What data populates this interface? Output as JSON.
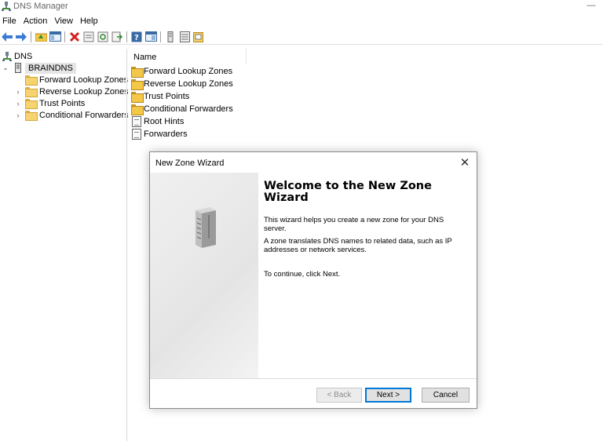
{
  "window": {
    "title": "DNS Manager",
    "minimize": "—"
  },
  "menu": [
    "File",
    "Action",
    "View",
    "Help"
  ],
  "tree": {
    "root": "DNS",
    "server": "BRAINDNS",
    "children": [
      "Forward Lookup Zones",
      "Reverse Lookup Zones",
      "Trust Points",
      "Conditional Forwarders"
    ]
  },
  "list": {
    "column": "Name",
    "items": [
      "Forward Lookup Zones",
      "Reverse Lookup Zones",
      "Trust Points",
      "Conditional Forwarders",
      "Root Hints",
      "Forwarders"
    ]
  },
  "dialog": {
    "title": "New Zone Wizard",
    "close": "✕",
    "heading_line1": "Welcome to the New Zone",
    "heading_line2": "Wizard",
    "para1_line1": "This wizard helps you create a new zone for your DNS",
    "para1_line2": "server.",
    "para2_line1": "A zone translates DNS names to related data, such as IP",
    "para2_line2": "addresses or network services.",
    "para3": "To continue, click Next.",
    "back_label": "< Back",
    "next_label": "Next >",
    "cancel_label": "Cancel"
  },
  "colors": {
    "accent": "#0078d7",
    "folder": "#f3c748"
  }
}
